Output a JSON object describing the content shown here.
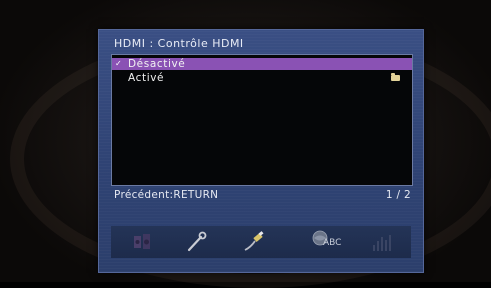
{
  "menu": {
    "title": "HDMI : Contrôle HDMI",
    "options": [
      {
        "label": "Désactivé",
        "selected": true,
        "checked": true
      },
      {
        "label": "Activé",
        "selected": false,
        "has_folder": true
      }
    ],
    "footer_hint": "Précédent:RETURN",
    "page_indicator": "1 / 2"
  },
  "icon_bar": {
    "icons": [
      {
        "name": "audio-icon",
        "dimmed": true
      },
      {
        "name": "wrench-icon",
        "dimmed": false
      },
      {
        "name": "hdmi-cable-icon",
        "dimmed": false
      },
      {
        "name": "globe-abc-icon",
        "dimmed": false,
        "text": "ABC"
      },
      {
        "name": "signal-bars-icon",
        "dimmed": true
      }
    ]
  },
  "colors": {
    "panel": "#33467a",
    "selection": "#8a52b4",
    "list_background": "#050608"
  }
}
